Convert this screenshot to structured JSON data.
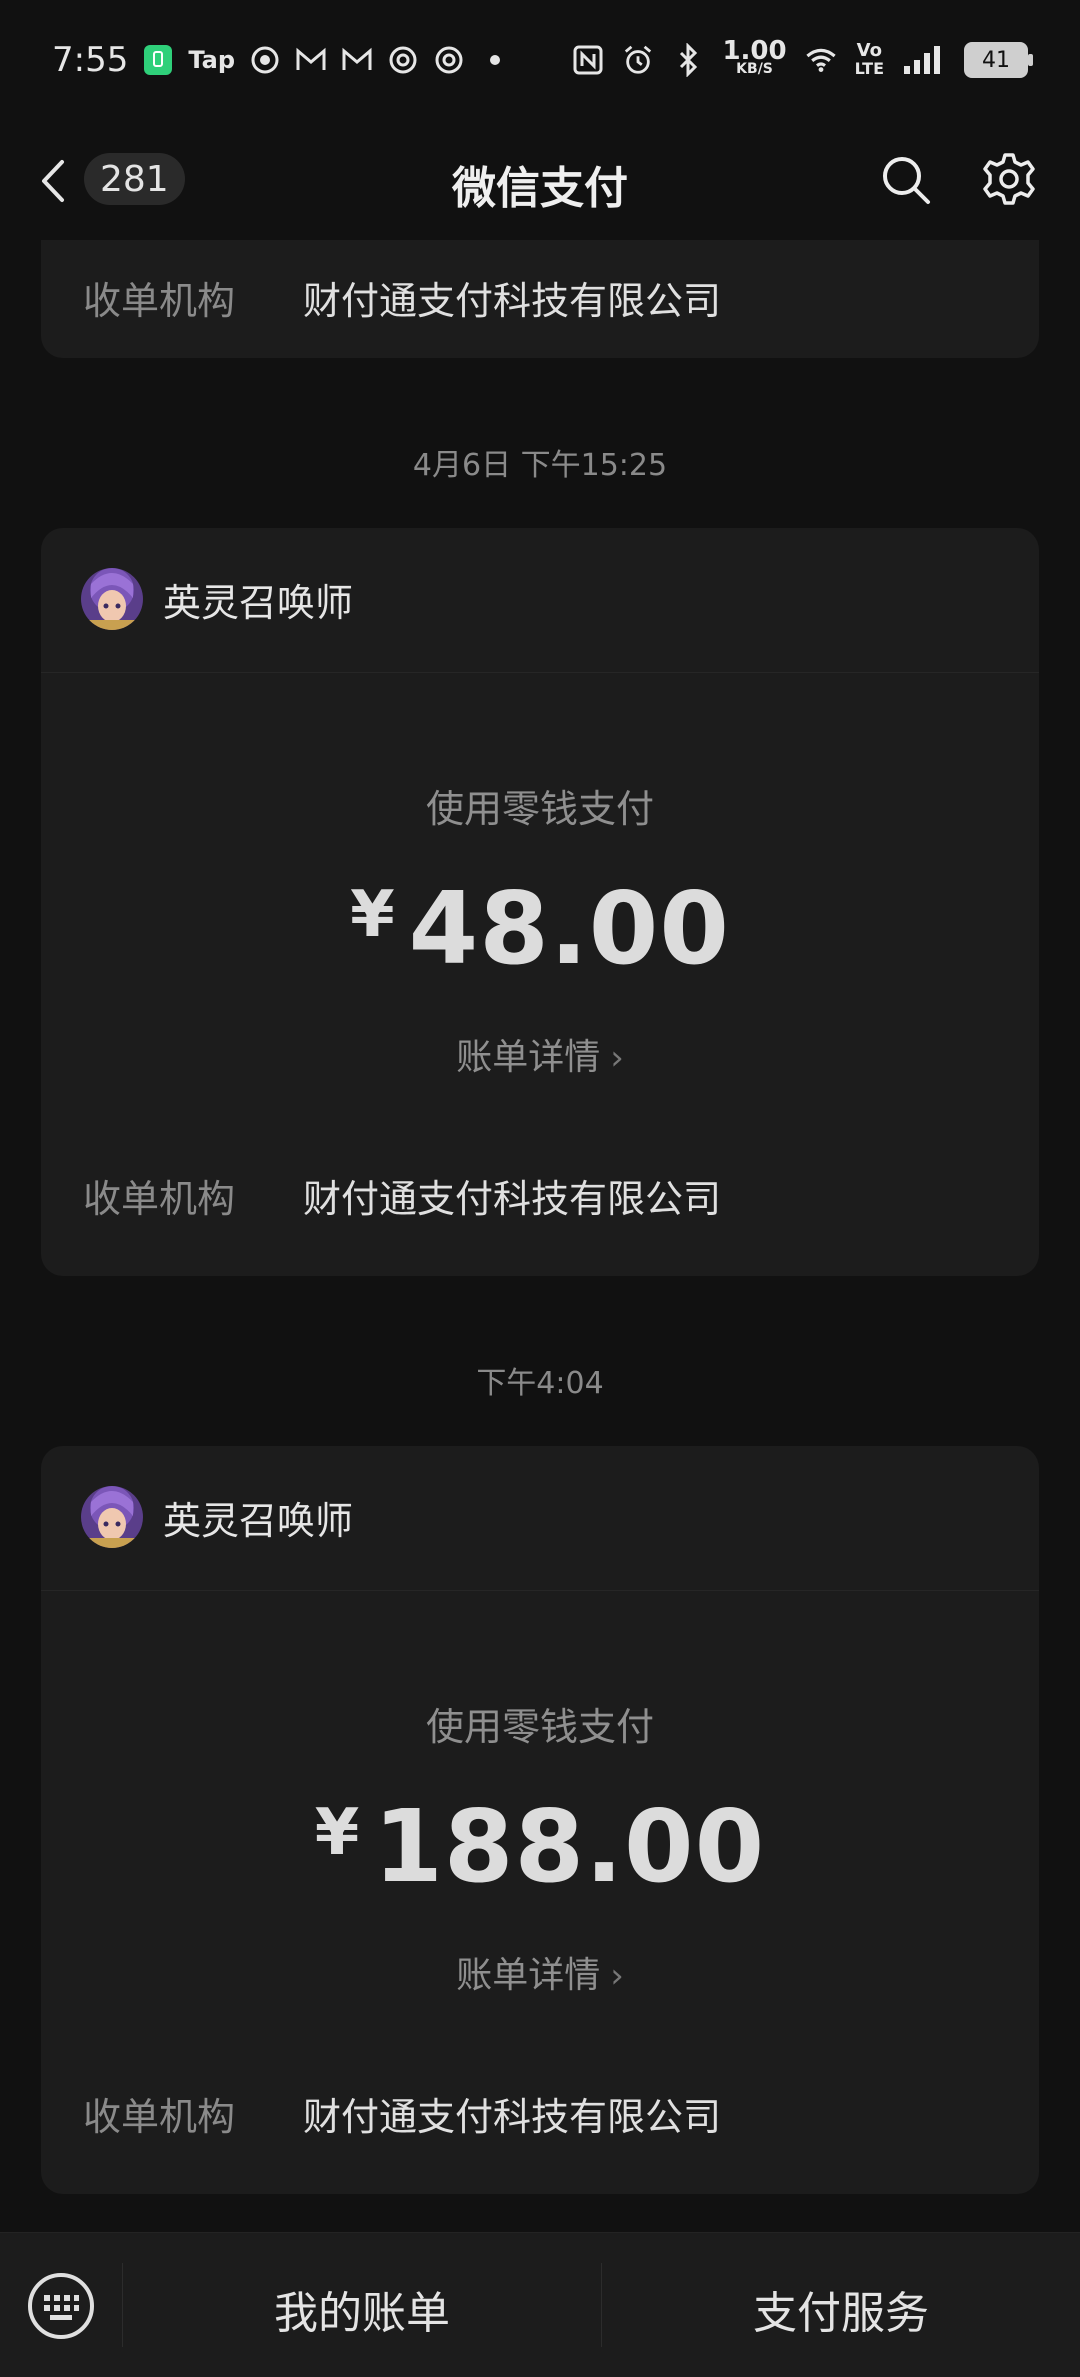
{
  "status_bar": {
    "time": "7:55",
    "tap_label": "Tap",
    "speed_value": "1.00",
    "speed_unit": "KB/S",
    "volte_top": "Vo",
    "volte_bottom": "LTE",
    "battery": "41"
  },
  "nav": {
    "badge_count": "281",
    "title": "微信支付"
  },
  "top_card": {
    "label": "收单机构",
    "value": "财付通支付科技有限公司"
  },
  "transactions": [
    {
      "time_header": "4月6日 下午15:25",
      "merchant": "英灵召唤师",
      "pay_method": "使用零钱支付",
      "currency": "¥",
      "amount": "48.00",
      "details_label": "账单详情",
      "acquirer_label": "收单机构",
      "acquirer_value": "财付通支付科技有限公司"
    },
    {
      "time_header": "下午4:04",
      "merchant": "英灵召唤师",
      "pay_method": "使用零钱支付",
      "currency": "¥",
      "amount": "188.00",
      "details_label": "账单详情",
      "acquirer_label": "收单机构",
      "acquirer_value": "财付通支付科技有限公司"
    }
  ],
  "bottom_bar": {
    "my_bill": "我的账单",
    "pay_service": "支付服务"
  },
  "icons": {
    "back": "chevron-left-icon",
    "search": "search-icon",
    "settings": "gear-icon",
    "keyboard": "keyboard-icon",
    "details_arrow": "chevron-right-icon"
  }
}
